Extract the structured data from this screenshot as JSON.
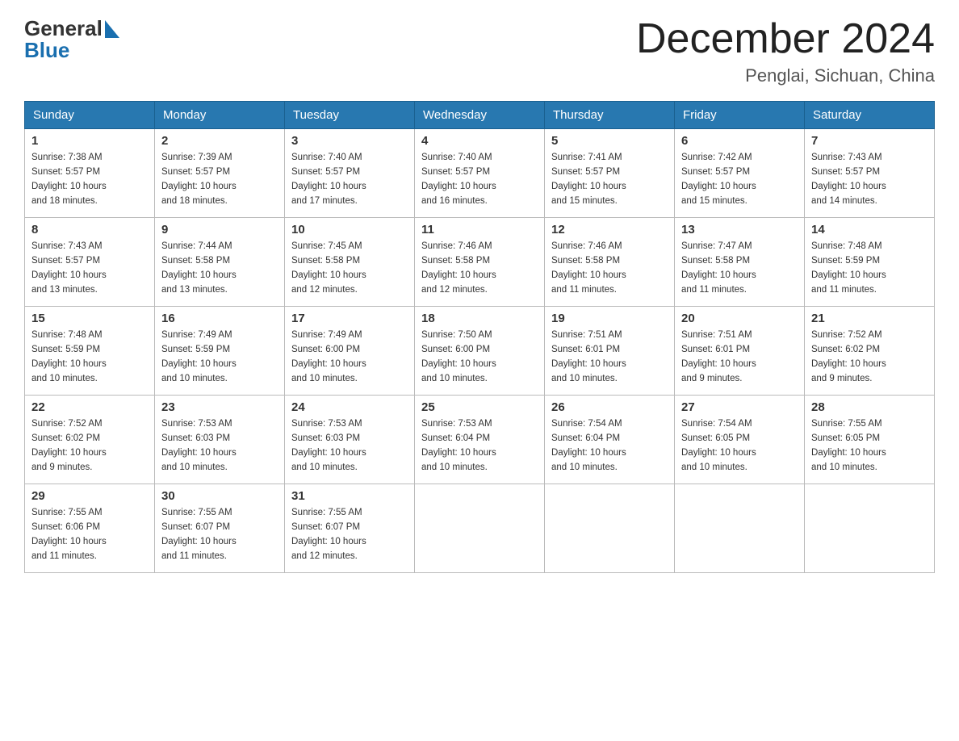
{
  "header": {
    "logo_general": "General",
    "logo_blue": "Blue",
    "month_title": "December 2024",
    "location": "Penglai, Sichuan, China"
  },
  "weekdays": [
    "Sunday",
    "Monday",
    "Tuesday",
    "Wednesday",
    "Thursday",
    "Friday",
    "Saturday"
  ],
  "weeks": [
    [
      {
        "day": "1",
        "sunrise": "7:38 AM",
        "sunset": "5:57 PM",
        "daylight": "10 hours and 18 minutes."
      },
      {
        "day": "2",
        "sunrise": "7:39 AM",
        "sunset": "5:57 PM",
        "daylight": "10 hours and 18 minutes."
      },
      {
        "day": "3",
        "sunrise": "7:40 AM",
        "sunset": "5:57 PM",
        "daylight": "10 hours and 17 minutes."
      },
      {
        "day": "4",
        "sunrise": "7:40 AM",
        "sunset": "5:57 PM",
        "daylight": "10 hours and 16 minutes."
      },
      {
        "day": "5",
        "sunrise": "7:41 AM",
        "sunset": "5:57 PM",
        "daylight": "10 hours and 15 minutes."
      },
      {
        "day": "6",
        "sunrise": "7:42 AM",
        "sunset": "5:57 PM",
        "daylight": "10 hours and 15 minutes."
      },
      {
        "day": "7",
        "sunrise": "7:43 AM",
        "sunset": "5:57 PM",
        "daylight": "10 hours and 14 minutes."
      }
    ],
    [
      {
        "day": "8",
        "sunrise": "7:43 AM",
        "sunset": "5:57 PM",
        "daylight": "10 hours and 13 minutes."
      },
      {
        "day": "9",
        "sunrise": "7:44 AM",
        "sunset": "5:58 PM",
        "daylight": "10 hours and 13 minutes."
      },
      {
        "day": "10",
        "sunrise": "7:45 AM",
        "sunset": "5:58 PM",
        "daylight": "10 hours and 12 minutes."
      },
      {
        "day": "11",
        "sunrise": "7:46 AM",
        "sunset": "5:58 PM",
        "daylight": "10 hours and 12 minutes."
      },
      {
        "day": "12",
        "sunrise": "7:46 AM",
        "sunset": "5:58 PM",
        "daylight": "10 hours and 11 minutes."
      },
      {
        "day": "13",
        "sunrise": "7:47 AM",
        "sunset": "5:58 PM",
        "daylight": "10 hours and 11 minutes."
      },
      {
        "day": "14",
        "sunrise": "7:48 AM",
        "sunset": "5:59 PM",
        "daylight": "10 hours and 11 minutes."
      }
    ],
    [
      {
        "day": "15",
        "sunrise": "7:48 AM",
        "sunset": "5:59 PM",
        "daylight": "10 hours and 10 minutes."
      },
      {
        "day": "16",
        "sunrise": "7:49 AM",
        "sunset": "5:59 PM",
        "daylight": "10 hours and 10 minutes."
      },
      {
        "day": "17",
        "sunrise": "7:49 AM",
        "sunset": "6:00 PM",
        "daylight": "10 hours and 10 minutes."
      },
      {
        "day": "18",
        "sunrise": "7:50 AM",
        "sunset": "6:00 PM",
        "daylight": "10 hours and 10 minutes."
      },
      {
        "day": "19",
        "sunrise": "7:51 AM",
        "sunset": "6:01 PM",
        "daylight": "10 hours and 10 minutes."
      },
      {
        "day": "20",
        "sunrise": "7:51 AM",
        "sunset": "6:01 PM",
        "daylight": "10 hours and 9 minutes."
      },
      {
        "day": "21",
        "sunrise": "7:52 AM",
        "sunset": "6:02 PM",
        "daylight": "10 hours and 9 minutes."
      }
    ],
    [
      {
        "day": "22",
        "sunrise": "7:52 AM",
        "sunset": "6:02 PM",
        "daylight": "10 hours and 9 minutes."
      },
      {
        "day": "23",
        "sunrise": "7:53 AM",
        "sunset": "6:03 PM",
        "daylight": "10 hours and 10 minutes."
      },
      {
        "day": "24",
        "sunrise": "7:53 AM",
        "sunset": "6:03 PM",
        "daylight": "10 hours and 10 minutes."
      },
      {
        "day": "25",
        "sunrise": "7:53 AM",
        "sunset": "6:04 PM",
        "daylight": "10 hours and 10 minutes."
      },
      {
        "day": "26",
        "sunrise": "7:54 AM",
        "sunset": "6:04 PM",
        "daylight": "10 hours and 10 minutes."
      },
      {
        "day": "27",
        "sunrise": "7:54 AM",
        "sunset": "6:05 PM",
        "daylight": "10 hours and 10 minutes."
      },
      {
        "day": "28",
        "sunrise": "7:55 AM",
        "sunset": "6:05 PM",
        "daylight": "10 hours and 10 minutes."
      }
    ],
    [
      {
        "day": "29",
        "sunrise": "7:55 AM",
        "sunset": "6:06 PM",
        "daylight": "10 hours and 11 minutes."
      },
      {
        "day": "30",
        "sunrise": "7:55 AM",
        "sunset": "6:07 PM",
        "daylight": "10 hours and 11 minutes."
      },
      {
        "day": "31",
        "sunrise": "7:55 AM",
        "sunset": "6:07 PM",
        "daylight": "10 hours and 12 minutes."
      },
      null,
      null,
      null,
      null
    ]
  ],
  "labels": {
    "sunrise": "Sunrise:",
    "sunset": "Sunset:",
    "daylight": "Daylight:"
  }
}
